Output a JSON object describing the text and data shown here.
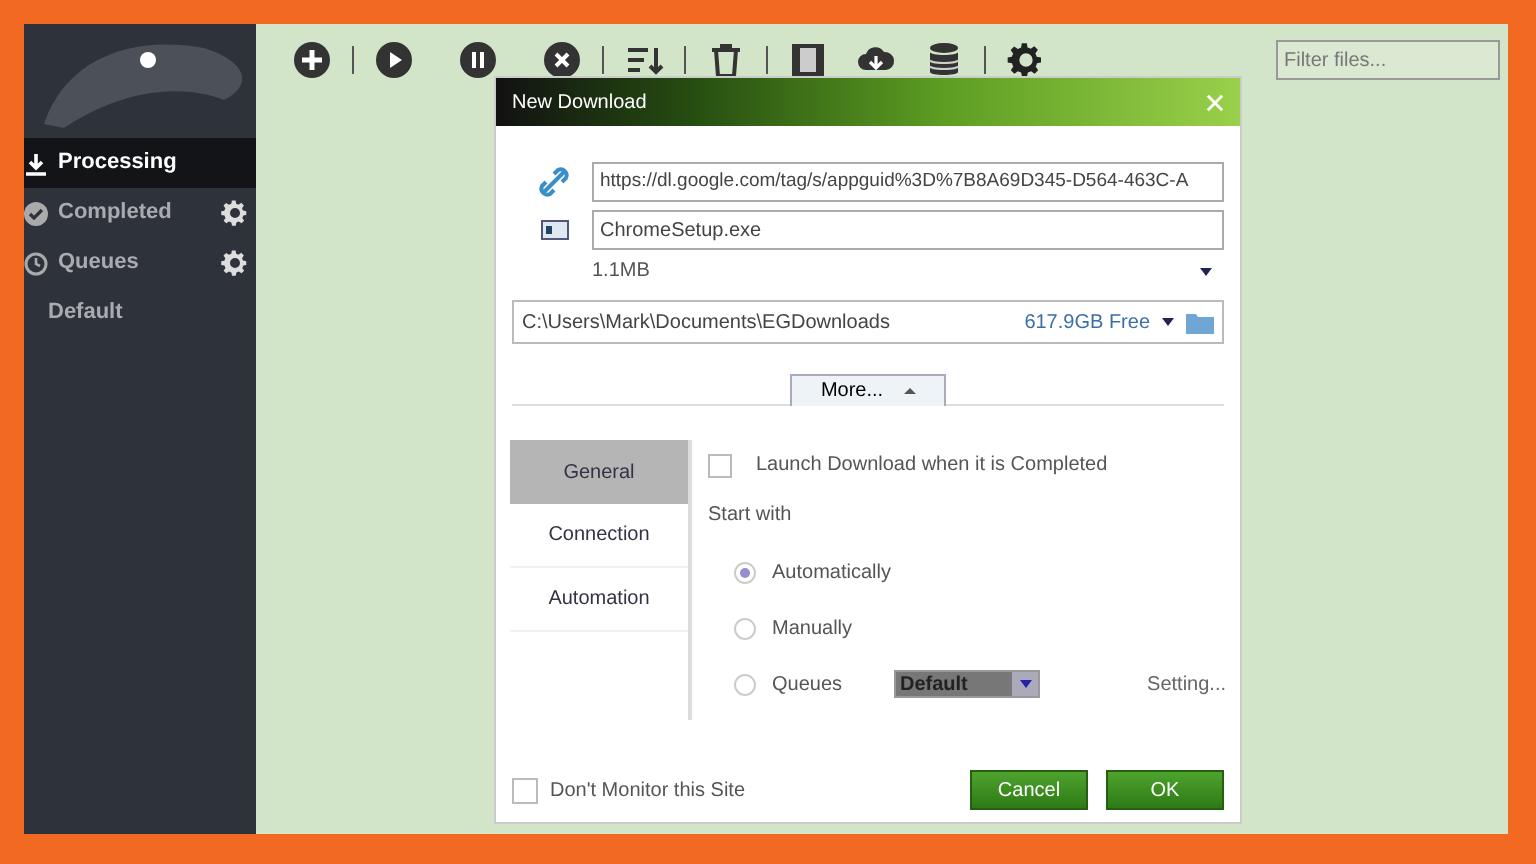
{
  "sidebar": {
    "items": [
      {
        "label": "Processing",
        "kind": "processing",
        "selected": true,
        "settings": false
      },
      {
        "label": "Completed",
        "kind": "completed",
        "selected": false,
        "settings": true
      },
      {
        "label": "Queues",
        "kind": "queues",
        "selected": false,
        "settings": true
      },
      {
        "label": "Default",
        "kind": "plain",
        "selected": false,
        "settings": false
      }
    ]
  },
  "filter": {
    "placeholder": "Filter files..."
  },
  "dialog": {
    "title": "New Download",
    "url": "https://dl.google.com/tag/s/appguid%3D%7B8A69D345-D564-463C-A",
    "filename": "ChromeSetup.exe",
    "size": "1.1MB",
    "folder": "C:\\Users\\Mark\\Documents\\EGDownloads",
    "free_space": "617.9GB Free",
    "more_button": "More...",
    "tabs": [
      {
        "label": "General",
        "selected": true
      },
      {
        "label": "Connection",
        "selected": false
      },
      {
        "label": "Automation",
        "selected": false
      }
    ],
    "launch": {
      "label": "Launch Download when it is Completed",
      "checked": false
    },
    "start_with": "Start with",
    "start_options": [
      {
        "label": "Automatically",
        "selected": true
      },
      {
        "label": "Manually",
        "selected": false
      },
      {
        "label": "Queues",
        "selected": false
      }
    ],
    "queue_select": "Default",
    "setting_link": "Setting...",
    "dont_monitor": {
      "label": "Don't Monitor this Site",
      "checked": false
    },
    "buttons": [
      {
        "label": "Cancel"
      },
      {
        "label": "OK"
      }
    ]
  }
}
